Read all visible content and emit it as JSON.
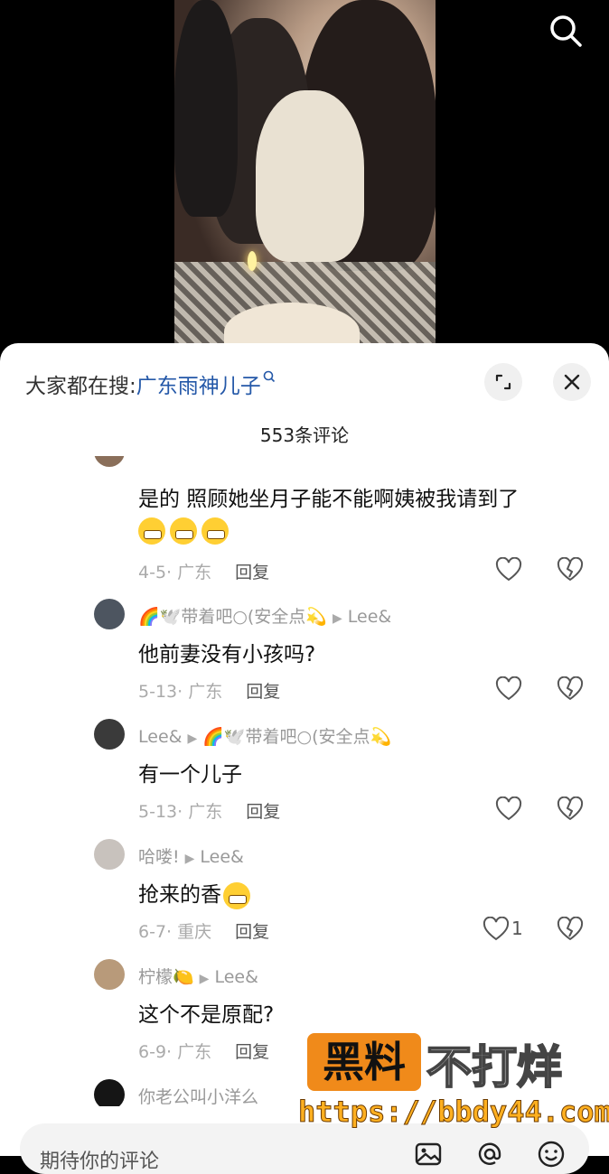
{
  "video": {
    "search_icon": "search-icon"
  },
  "sheet": {
    "search_prefix": "大家都在搜:",
    "search_keyword": "广东雨神儿子",
    "comment_count": "553条评论"
  },
  "comments": [
    {
      "body": "是的 照顾她坐月子能不能啊姨被我请到了",
      "emoji_count": 3,
      "date": "4-5",
      "location": "广东",
      "reply_label": "回复"
    },
    {
      "author": "🌈🕊️带着吧○(安全点💫",
      "reply_to": "Lee&",
      "body": "他前妻没有小孩吗?",
      "date": "5-13",
      "location": "广东",
      "reply_label": "回复"
    },
    {
      "author": "Lee&",
      "reply_to": "🌈🕊️带着吧○(安全点💫",
      "body": "有一个儿子",
      "date": "5-13",
      "location": "广东",
      "reply_label": "回复"
    },
    {
      "author": "哈喽!",
      "reply_to": "Lee&",
      "body": "抢来的香",
      "date": "6-7",
      "location": "重庆",
      "reply_label": "回复",
      "likes": "1"
    },
    {
      "author": "柠檬🍋",
      "reply_to": "Lee&",
      "body": "这个不是原配?",
      "date": "6-9",
      "location": "广东",
      "reply_label": "回复"
    },
    {
      "author": "你老公叫小洋么"
    }
  ],
  "input": {
    "placeholder": "期待你的评论"
  },
  "watermark": {
    "brand": "黑料",
    "slogan": "不打烊",
    "url": "https://bbdy44.com"
  }
}
